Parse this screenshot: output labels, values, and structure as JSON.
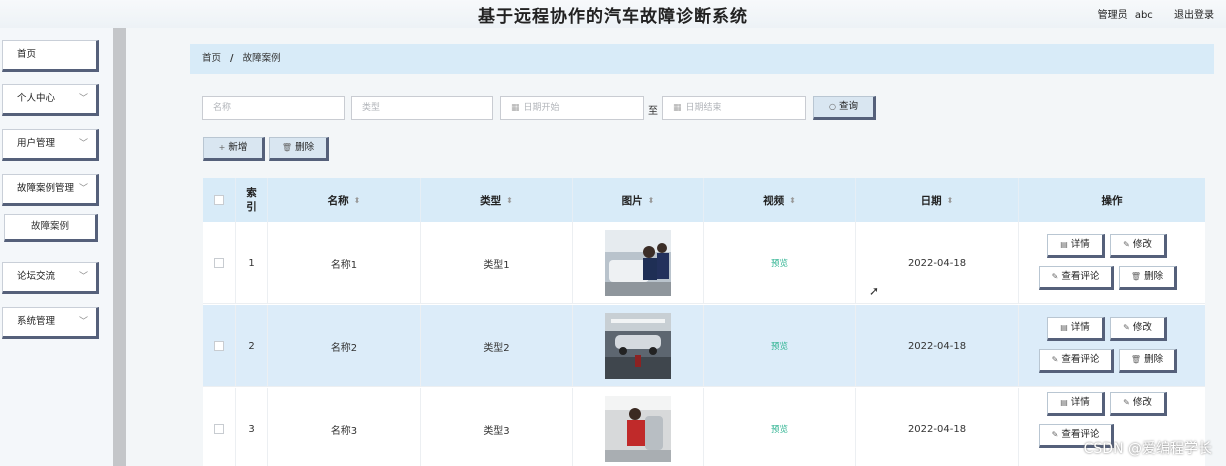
{
  "header": {
    "title": "基于远程协作的汽车故障诊断系统",
    "user_role": "管理员",
    "username": "abc",
    "logout_label": "退出登录"
  },
  "sidebar": {
    "items": [
      {
        "label": "首页",
        "has_chevron": false
      },
      {
        "label": "个人中心",
        "has_chevron": true
      },
      {
        "label": "用户管理",
        "has_chevron": true
      },
      {
        "label": "故障案例管理",
        "has_chevron": true
      },
      {
        "label": "论坛交流",
        "has_chevron": true
      },
      {
        "label": "系统管理",
        "has_chevron": true
      }
    ],
    "sub_items": [
      {
        "label": "故障案例"
      }
    ],
    "chevron_icon": "chevron-down-icon"
  },
  "breadcrumb": {
    "home": "首页",
    "separator": "/",
    "current": "故障案例"
  },
  "search": {
    "name_placeholder": "名称",
    "type_placeholder": "类型",
    "date_start_placeholder": "日期开始",
    "date_end_placeholder": "日期结束",
    "to_label": "至",
    "search_label": "查询",
    "search_icon": "search-icon",
    "calendar_icon": "calendar-icon"
  },
  "toolbar": {
    "add_label": "新增",
    "delete_label": "删除",
    "add_icon": "plus-icon",
    "delete_icon": "trash-icon"
  },
  "table": {
    "columns": [
      "索引",
      "名称",
      "类型",
      "图片",
      "视频",
      "日期",
      "操作"
    ],
    "rows": [
      {
        "index": "1",
        "name": "名称1",
        "type": "类型1",
        "video": "预览",
        "date": "2022-04-18"
      },
      {
        "index": "2",
        "name": "名称2",
        "type": "类型2",
        "video": "预览",
        "date": "2022-04-18"
      },
      {
        "index": "3",
        "name": "名称3",
        "type": "类型3",
        "video": "预览",
        "date": "2022-04-18"
      }
    ],
    "actions": {
      "detail": "详情",
      "edit": "修改",
      "comments": "查看评论",
      "delete": "删除"
    }
  },
  "watermark": "CSDN @爱编程学长",
  "colors": {
    "accent_light": "#d8ebf8",
    "button_shadow": "#55607a",
    "video_link": "#2ab28f"
  }
}
